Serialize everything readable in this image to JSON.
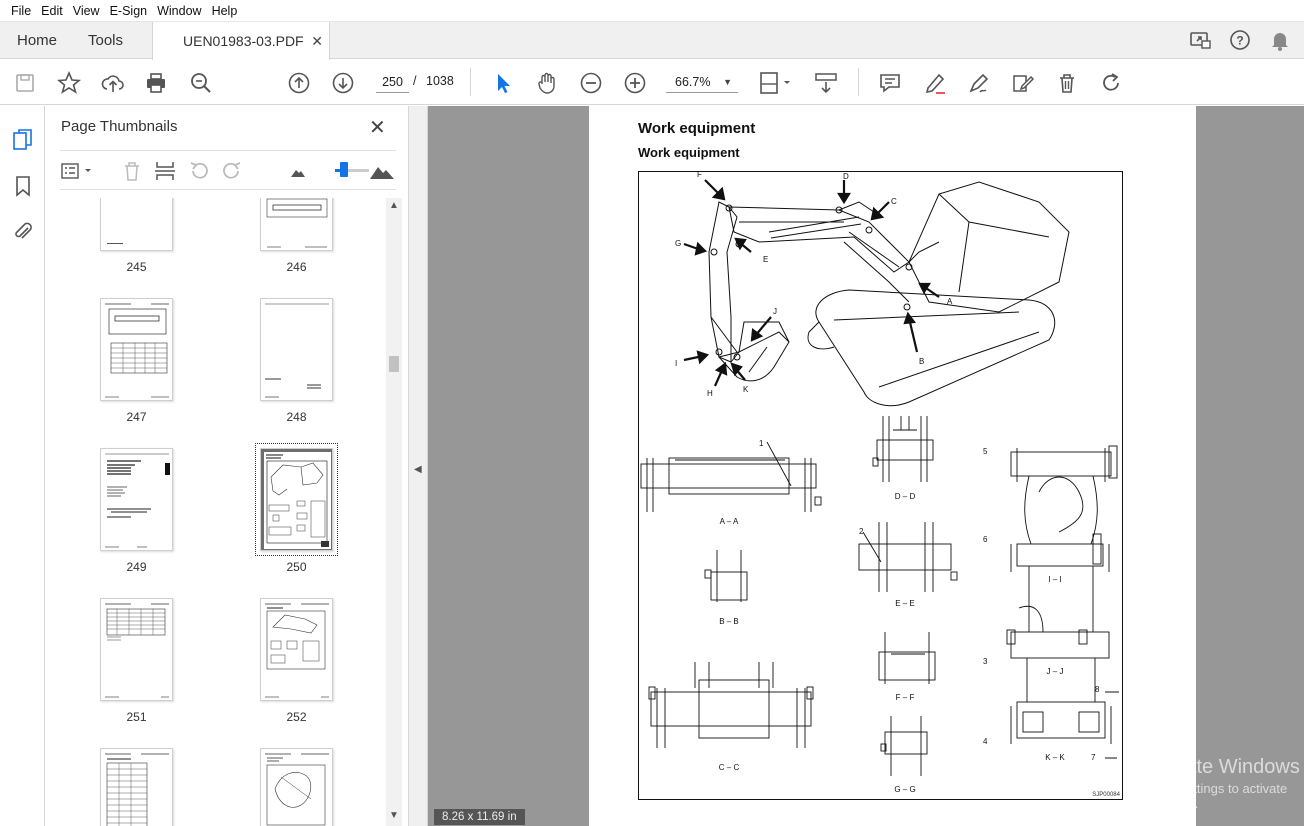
{
  "menu": [
    "File",
    "Edit",
    "View",
    "E-Sign",
    "Window",
    "Help"
  ],
  "tabs": {
    "home": "Home",
    "tools": "Tools",
    "document": "UEN01983-03.PDF"
  },
  "toolbar": {
    "page_current": "250",
    "page_separator": "/",
    "page_total": "1038",
    "zoom": "66.7%"
  },
  "thumbnails_panel": {
    "title": "Page Thumbnails",
    "pages": [
      "245",
      "246",
      "247",
      "248",
      "249",
      "250",
      "251",
      "252"
    ],
    "selected": "250"
  },
  "document": {
    "title": "Work equipment",
    "subtitle": "Work equipment",
    "figure_code": "SJP00084",
    "callouts": [
      "A",
      "B",
      "C",
      "D",
      "E",
      "F",
      "G",
      "H",
      "I",
      "J",
      "K"
    ],
    "sections": [
      "A – A",
      "B – B",
      "C – C",
      "D – D",
      "E – E",
      "F – F",
      "G – G",
      "I – I",
      "J – J",
      "K – K"
    ],
    "numbers": [
      "1",
      "2",
      "3",
      "4",
      "5",
      "6",
      "7",
      "8"
    ],
    "page_size": "8.26 x 11.69 in"
  },
  "watermark": {
    "line1": "Activate Windows",
    "line2": "Go to Settings to activate Windows."
  },
  "colors": {
    "accent": "#1473e6",
    "doc_bg": "#979797",
    "chrome": "#f0f0f0"
  }
}
